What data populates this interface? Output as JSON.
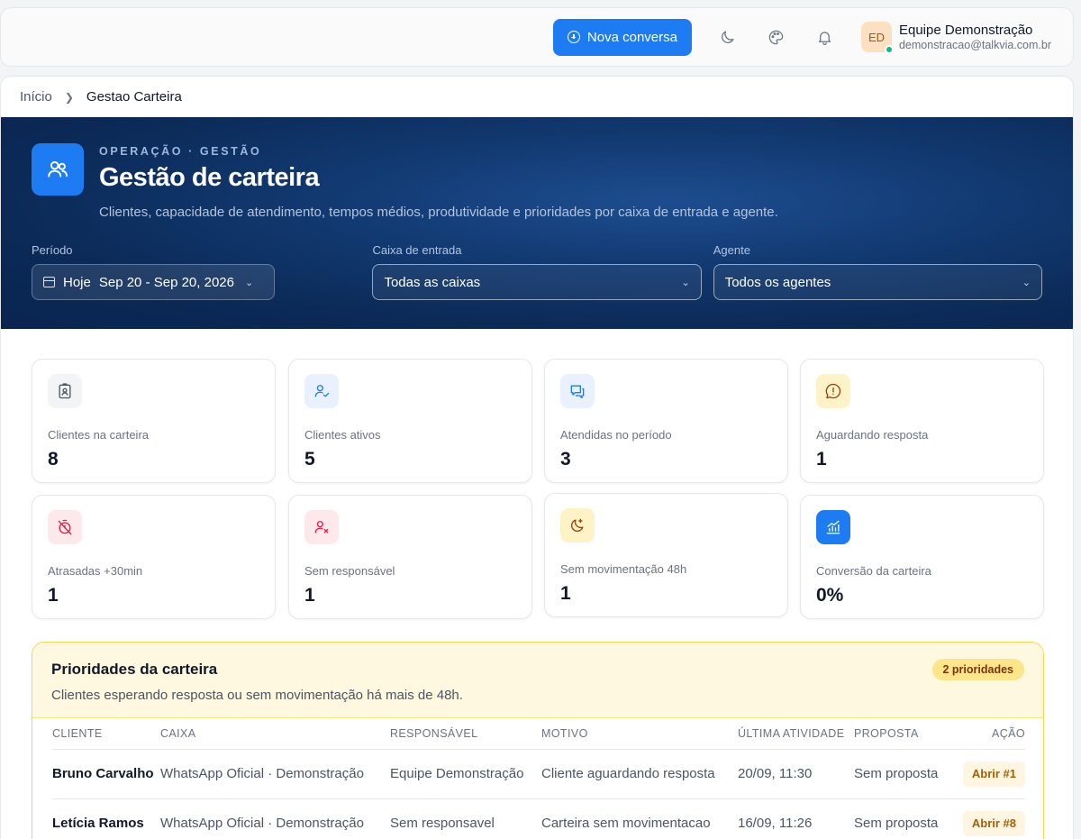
{
  "topbar": {
    "new_conversation": "Nova conversa",
    "user": {
      "initials": "ED",
      "name": "Equipe Demonstração",
      "email": "demonstracao@talkvia.com.br"
    }
  },
  "breadcrumb": {
    "home": "Início",
    "current": "Gestao Carteira"
  },
  "hero": {
    "eyebrow": "OPERAÇÃO · GESTÃO",
    "title": "Gestão de carteira",
    "subtitle": "Clientes, capacidade de atendimento, tempos médios, produtividade e prioridades por caixa de entrada e agente.",
    "filters": {
      "period_label": "Período",
      "period_preset": "Hoje",
      "period_range": "Sep 20 - Sep 20, 2026",
      "inbox_label": "Caixa de entrada",
      "inbox_value": "Todas as caixas",
      "agent_label": "Agente",
      "agent_value": "Todos os agentes"
    }
  },
  "cards": [
    {
      "label": "Clientes na carteira",
      "value": "8",
      "icon": "id-badge-icon",
      "color": "#f3f4f6"
    },
    {
      "label": "Clientes ativos",
      "value": "5",
      "icon": "user-check-icon",
      "color": "#e8f1fd"
    },
    {
      "label": "Atendidas no período",
      "value": "3",
      "icon": "chat-bubbles-icon",
      "color": "#e8f1fd"
    },
    {
      "label": "Aguardando resposta",
      "value": "1",
      "icon": "alert-bubble-icon",
      "color": "#fef3c7"
    },
    {
      "label": "Atrasadas +30min",
      "value": "1",
      "icon": "timer-off-icon",
      "color": "#fde8ec"
    },
    {
      "label": "Sem responsável",
      "value": "1",
      "icon": "user-x-icon",
      "color": "#fde8ec"
    },
    {
      "label": "Sem movimentação 48h",
      "value": "1",
      "icon": "moon-star-icon",
      "color": "#fef3c7"
    },
    {
      "label": "Conversão da carteira",
      "value": "0%",
      "icon": "chart-up-icon",
      "color": "#1d7cf2"
    }
  ],
  "priorities": {
    "title": "Prioridades da carteira",
    "subtitle": "Clientes esperando resposta ou sem movimentação há mais de 48h.",
    "badge": "2 prioridades",
    "columns": [
      "CLIENTE",
      "CAIXA",
      "RESPONSÁVEL",
      "MOTIVO",
      "ÚLTIMA ATIVIDADE",
      "PROPOSTA",
      "AÇÃO"
    ],
    "rows": [
      {
        "client": "Bruno Carvalho",
        "inbox": "WhatsApp Oficial · Demonstração",
        "owner": "Equipe Demonstração",
        "reason": "Cliente aguardando resposta",
        "last": "20/09, 11:30",
        "proposal": "Sem proposta",
        "action": "Abrir #1"
      },
      {
        "client": "Letícia Ramos",
        "inbox": "WhatsApp Oficial · Demonstração",
        "owner": "Sem responsavel",
        "reason": "Carteira sem movimentacao",
        "last": "16/09, 11:26",
        "proposal": "Sem proposta",
        "action": "Abrir #8"
      }
    ]
  }
}
